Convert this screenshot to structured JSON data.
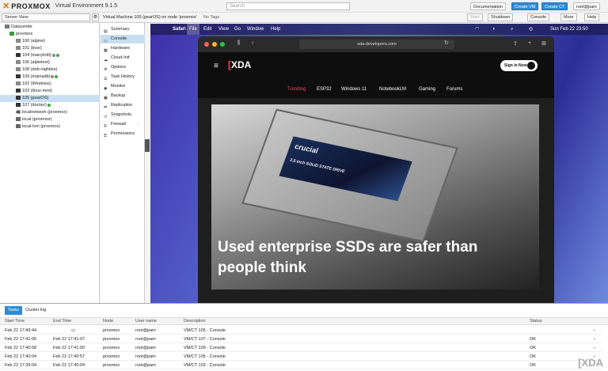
{
  "app": {
    "brand": "PROXMOX",
    "version": "Virtual Environment 9.1.5",
    "search_placeholder": "Search",
    "buttons": [
      "Documentation",
      "Create VM",
      "Create CT",
      "root@pam"
    ]
  },
  "toolbar": {
    "server_view": "Server View",
    "vm_title": "Virtual Machine 105 (pearOS) on node 'proxmox'",
    "no_tags": "No Tags",
    "actions": [
      "Start",
      "Shutdown",
      "Console",
      "More",
      "Help"
    ]
  },
  "tree": {
    "datacenter": "Datacenter",
    "node": "proxmox",
    "items": [
      {
        "label": "100 (alpine)",
        "status": ""
      },
      {
        "label": "101 (tnse)",
        "status": ""
      },
      {
        "label": "104 (manyfold)",
        "status": "running"
      },
      {
        "label": "106 (alpietest)",
        "status": ""
      },
      {
        "label": "108 (deb-nightles)",
        "status": ""
      },
      {
        "label": "109 (mainadb)",
        "status": "running"
      },
      {
        "label": "102 (Windows)",
        "status": ""
      },
      {
        "label": "103 (linux-mint)",
        "status": ""
      },
      {
        "label": "105 (pearOS)",
        "status": "selected"
      },
      {
        "label": "107 (docker)",
        "status": "running"
      },
      {
        "label": "localnetwork (proxmox)",
        "status": ""
      },
      {
        "label": "local (proxmox)",
        "status": ""
      },
      {
        "label": "local-lvm (proxmox)",
        "status": ""
      }
    ]
  },
  "menu": {
    "items": [
      "Summary",
      "Console",
      "Hardware",
      "Cloud-Init",
      "Options",
      "Task History",
      "Monitor",
      "Backup",
      "Replication",
      "Snapshots",
      "Firewall",
      "Permissions"
    ],
    "selected": "Console"
  },
  "guest": {
    "menubar": [
      "Safari",
      "File",
      "Edit",
      "View",
      "Go",
      "Window",
      "Help"
    ],
    "clock": "Sun Feb 22 23:50",
    "url": "xda-developers.com",
    "site_logo": "XDA",
    "sign_in": "Sign In Now",
    "nav": [
      "Trending",
      "ESP32",
      "Windows 11",
      "NotebookLM",
      "Gaming",
      "Forums"
    ],
    "ssd_label": "crucial",
    "ssd_sub": "2.5-inch SOLID STATE DRIVE",
    "headline": "Used enterprise SSDs are safer than people think"
  },
  "tasks": {
    "tabs": [
      "Tasks",
      "Cluster log"
    ],
    "columns": [
      "Start Time",
      "End Time",
      "Node",
      "User name",
      "Description",
      "Status"
    ],
    "rows": [
      {
        "start": "Feb 22 17:49:44",
        "end": "",
        "node": "proxmox",
        "user": "root@pam",
        "desc": "VM/CT 105 - Console",
        "status": ""
      },
      {
        "start": "Feb 22 17:41:05",
        "end": "Feb 22 17:41:07",
        "node": "proxmox",
        "user": "root@pam",
        "desc": "VM/CT 107 - Console",
        "status": "OK"
      },
      {
        "start": "Feb 22 17:40:58",
        "end": "Feb 22 17:41:00",
        "node": "proxmox",
        "user": "root@pam",
        "desc": "VM/CT 109 - Console",
        "status": "OK"
      },
      {
        "start": "Feb 22 17:40:04",
        "end": "Feb 22 17:40:57",
        "node": "proxmox",
        "user": "root@pam",
        "desc": "VM/CT 105 - Console",
        "status": "OK"
      },
      {
        "start": "Feb 22 17:39:04",
        "end": "Feb 22 17:40:04",
        "node": "proxmox",
        "user": "root@pam",
        "desc": "VM/CT 103 - Console",
        "status": "OK"
      }
    ]
  },
  "watermark": "XDA"
}
